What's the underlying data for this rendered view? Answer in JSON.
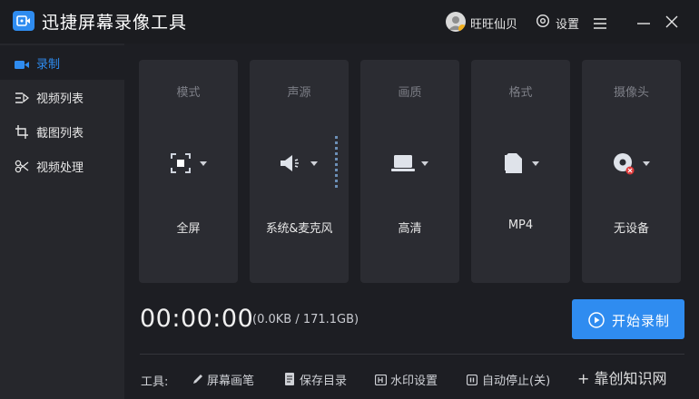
{
  "app": {
    "title": "迅捷屏幕录像工具"
  },
  "header": {
    "user_name": "旺旺仙贝",
    "settings_label": "设置",
    "icons": [
      "settings-icon",
      "menu-icon",
      "minimize-icon",
      "close-icon"
    ]
  },
  "sidebar": {
    "items": [
      {
        "label": "录制",
        "icon": "camera-icon",
        "active": true
      },
      {
        "label": "视频列表",
        "icon": "video-list-icon",
        "active": false
      },
      {
        "label": "截图列表",
        "icon": "screenshot-list-icon",
        "active": false
      },
      {
        "label": "视频处理",
        "icon": "video-process-icon",
        "active": false
      }
    ]
  },
  "cards": [
    {
      "heading": "模式",
      "value": "全屏",
      "icon": "fullscreen-icon"
    },
    {
      "heading": "声源",
      "value": "系统&麦克风",
      "icon": "speaker-icon"
    },
    {
      "heading": "画质",
      "value": "高清",
      "icon": "laptop-icon"
    },
    {
      "heading": "格式",
      "value": "MP4",
      "icon": "file-icon"
    },
    {
      "heading": "摄像头",
      "value": "无设备",
      "icon": "webcam-disabled-icon"
    }
  ],
  "recording": {
    "timer": "00:00:00",
    "size_info": "(0.0KB / 171.1GB)",
    "start_label": "开始录制"
  },
  "tools": {
    "label": "工具:",
    "items": [
      {
        "label": "屏幕画笔",
        "icon": "pen-icon"
      },
      {
        "label": "保存目录",
        "icon": "folder-icon"
      },
      {
        "label": "水印设置",
        "icon": "watermark-icon"
      },
      {
        "label": "自动停止(关)",
        "icon": "auto-stop-icon"
      }
    ]
  },
  "watermark_text": "+ 靠创知识网",
  "colors": {
    "accent": "#2f8cf0",
    "background": "#1d1e23",
    "sidebar": "#26272c",
    "card": "#2b2c32"
  }
}
